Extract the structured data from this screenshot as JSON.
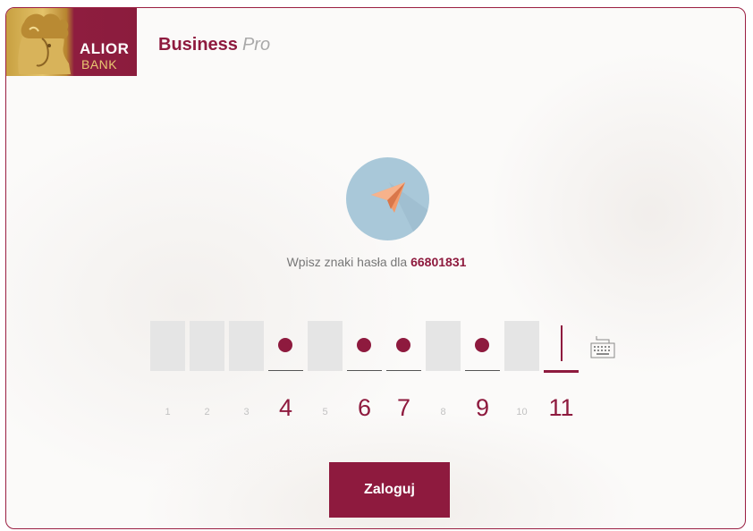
{
  "logo": {
    "line1": "ALIOR",
    "line2": "BANK"
  },
  "brand": {
    "main": "Business",
    "sub": "Pro"
  },
  "prompt": {
    "text": "Wpisz znaki hasła dla",
    "account": "66801831"
  },
  "password": {
    "slots": [
      {
        "position": "1",
        "state": "disabled"
      },
      {
        "position": "2",
        "state": "disabled"
      },
      {
        "position": "3",
        "state": "disabled"
      },
      {
        "position": "4",
        "state": "filled"
      },
      {
        "position": "5",
        "state": "disabled"
      },
      {
        "position": "6",
        "state": "filled"
      },
      {
        "position": "7",
        "state": "filled"
      },
      {
        "position": "8",
        "state": "disabled"
      },
      {
        "position": "9",
        "state": "filled"
      },
      {
        "position": "10",
        "state": "disabled"
      },
      {
        "position": "11",
        "state": "current"
      }
    ]
  },
  "icons": {
    "hero": "paper-plane-icon",
    "keyboard": "keyboard-icon"
  },
  "login_button": {
    "label": "Zaloguj"
  },
  "colors": {
    "brand": "#8e1a3e",
    "disabled_slot": "#e5e5e5",
    "hero_circle": "#a9c8d9",
    "plane": "#f39a6a"
  }
}
